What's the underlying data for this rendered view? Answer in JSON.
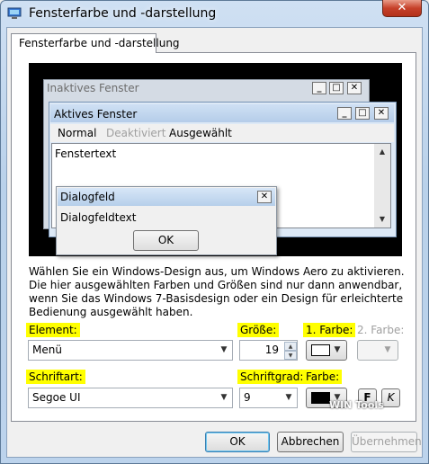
{
  "window": {
    "title": "Fensterfarbe und -darstellung",
    "close_label": "✕"
  },
  "tab": {
    "label": "Fensterfarbe und -darstellung"
  },
  "preview": {
    "inactive_title": "Inaktives Fenster",
    "active_title": "Aktives Fenster",
    "menu": [
      "Normal",
      "Deaktiviert",
      "Ausgewählt"
    ],
    "window_text": "Fenstertext",
    "dialog_title": "Dialogfeld",
    "dialog_text": "Dialogfeldtext",
    "dialog_ok": "OK",
    "caption_buttons": [
      "_",
      "□",
      "✕"
    ]
  },
  "description": "Wählen Sie ein Windows-Design aus, um Windows Aero zu aktivieren. Die hier ausgewählten Farben und Größen sind nur dann anwendbar, wenn Sie das Windows 7-Basisdesign oder ein Design für erleichterte Bedienung ausgewählt haben.",
  "labels": {
    "element": "Element:",
    "size": "Größe:",
    "color1": "1. Farbe:",
    "color2": "2. Farbe:",
    "font": "Schriftart:",
    "font_size": "Schriftgrad:",
    "font_color": "Farbe:"
  },
  "controls": {
    "element_value": "Menü",
    "size_value": "19",
    "font_value": "Segoe UI",
    "font_size_value": "9",
    "bold_label": "F",
    "italic_label": "K",
    "color1_swatch": "#ffffff",
    "font_color_swatch": "#000000"
  },
  "buttons": {
    "ok": "OK",
    "cancel": "Abbrechen",
    "apply": "Übernehmen"
  },
  "watermark": "WIN Tools",
  "colors": {
    "highlight": "#ffff00",
    "title_bar": "#b9d1ea",
    "close": "#c6412a"
  }
}
